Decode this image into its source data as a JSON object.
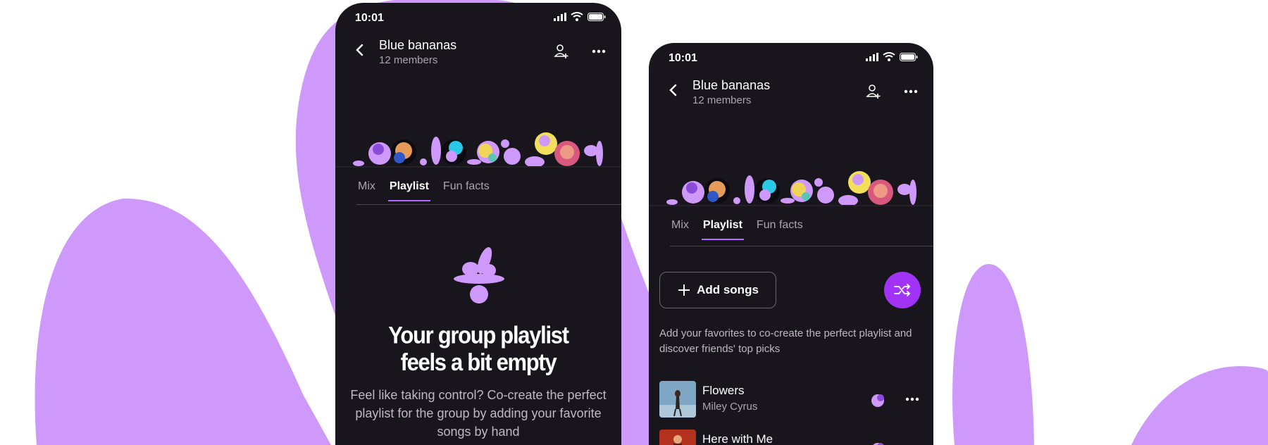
{
  "colors": {
    "accent": "#b06dff",
    "blob": "#cf99fb",
    "phone_bg": "#18161c",
    "shuffle": "#a033f5"
  },
  "status_bar": {
    "time": "10:01",
    "icons": [
      "signal-icon",
      "wifi-icon",
      "battery-icon"
    ]
  },
  "group": {
    "name": "Blue bananas",
    "members": "12 members"
  },
  "header_icons": [
    "back-icon",
    "add-member-icon",
    "more-icon"
  ],
  "tabs": [
    {
      "label": "Mix",
      "active": false
    },
    {
      "label": "Playlist",
      "active": true
    },
    {
      "label": "Fun facts",
      "active": false
    }
  ],
  "empty_state": {
    "title_line1": "Your group playlist",
    "title_line2": "feels a bit empty",
    "text": "Feel like taking control? Co-create the perfect playlist for the group by adding your favorite songs by hand"
  },
  "playlist": {
    "add_label": "Add songs",
    "description": "Add your favorites to co-create the perfect playlist and discover friends' top picks",
    "songs": [
      {
        "title": "Flowers",
        "artist": "Miley Cyrus"
      },
      {
        "title": "Here with Me",
        "artist": ""
      }
    ]
  }
}
